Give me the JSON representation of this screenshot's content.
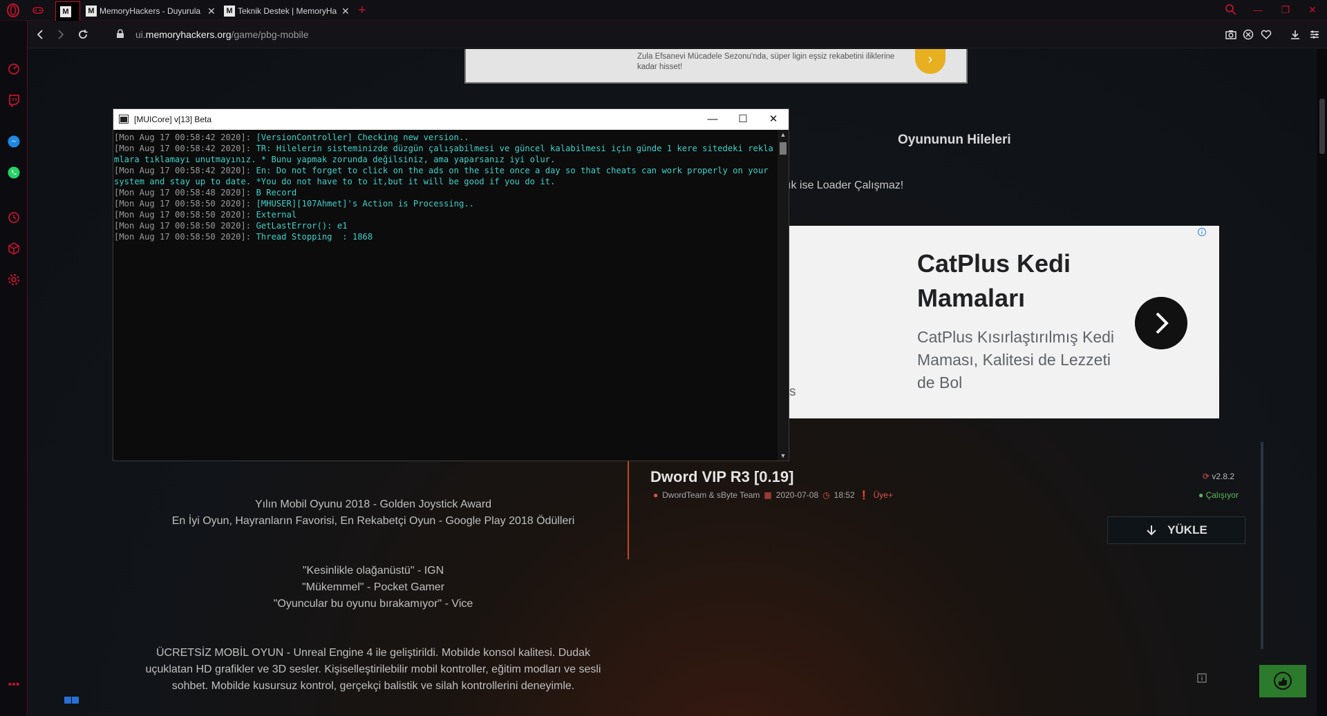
{
  "browser": {
    "tabs": [
      {
        "title": "MemoryHackers - Duyurula",
        "favicon": "M"
      },
      {
        "title": "Teknik Destek | MemoryHa",
        "favicon": "M"
      }
    ],
    "active_tab_favicon": "M",
    "url_prefix": "ui.",
    "url_domain": "memoryhackers.org",
    "url_path": "/game/pbg-mobile",
    "accent_color": "#c4132c"
  },
  "top_ad": {
    "text": "Zula Efsanevi Mücadele Sezonu'nda, süper ligin eşsiz rekabetini iliklerine kadar hisset!"
  },
  "section": {
    "title": "Oyununun Hileleri",
    "warning": "ık ise Loader Çalışmaz!"
  },
  "big_ad": {
    "headline": "CatPlus Kedi Mamaları",
    "description": "CatPlus Kısırlaştırılmış Kedi Maması, Kalitesi de Lezzeti de Bol",
    "leftover": "s"
  },
  "description": {
    "award1": "Yılın Mobil Oyunu 2018 - Golden Joystick Award",
    "award2": "En İyi Oyun, Hayranların Favorisi, En Rekabetçi Oyun - Google Play 2018 Ödülleri",
    "quote1": "\"Kesinlikle olağanüstü\" - IGN",
    "quote2": "\"Mükemmel\" - Pocket Gamer",
    "quote3": "\"Oyuncular bu oyunu bırakamıyor\" - Vice",
    "free1": "ÜCRETSİZ MOBİL OYUN - Unreal Engine 4 ile geliştirildi. Mobilde konsol kalitesi. Dudak",
    "free2": "uçuklatan HD grafikler ve 3D sesler. Kişiselleştirilebilir mobil kontroller, eğitim modları ve sesli",
    "free3": "sohbet. Mobilde kusursuz kontrol, gerçekçi balistik ve silah kontrollerini deneyimle."
  },
  "cheat": {
    "title": "Dword VIP R3 [0.19]",
    "authors": "DwordTeam & sByte Team",
    "date": "2020-07-08",
    "time": "18:52",
    "access": "Üye+",
    "version": "v2.8.2",
    "status": "Çalışıyor",
    "load_label": "YÜKLE"
  },
  "console": {
    "title": "[MUICore] v[13] Beta",
    "lines": [
      {
        "ts": "[Mon Aug 17 00:58:42 2020]: ",
        "msg": "[VersionController] Checking new version.."
      },
      {
        "ts": "[Mon Aug 17 00:58:42 2020]: ",
        "msg": "TR: Hilelerin sisteminizde düzgün çalışabilmesi ve güncel kalabilmesi için günde 1 kere sitedeki reklamlara tıklamayı unutmayınız. * Bunu yapmak zorunda değilsiniz, ama yaparsanız iyi olur."
      },
      {
        "ts": "[Mon Aug 17 00:58:42 2020]: ",
        "msg": "En: Do not forget to click on the ads on the site once a day so that cheats can work properly on your system and stay up to date. *You do not have to to it,but it will be good if you do it."
      },
      {
        "ts": "[Mon Aug 17 00:58:48 2020]: ",
        "msg": "B Record"
      },
      {
        "ts": "[Mon Aug 17 00:58:50 2020]: ",
        "msg": "[MHUSER][107Ahmet]'s Action is Processing.."
      },
      {
        "ts": "[Mon Aug 17 00:58:50 2020]: ",
        "msg": "External"
      },
      {
        "ts": "[Mon Aug 17 00:58:50 2020]: ",
        "msg": "GetLastError(): e1"
      },
      {
        "ts": "[Mon Aug 17 00:58:50 2020]: ",
        "msg": "Thread Stopping  : 1868"
      }
    ]
  }
}
